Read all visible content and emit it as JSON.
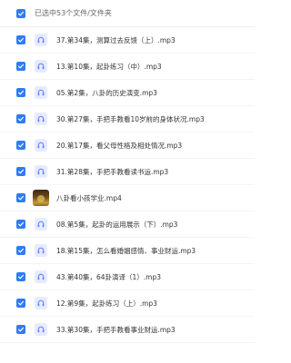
{
  "header": {
    "selected_label": "已选中53个文件/文件夹"
  },
  "files": [
    {
      "name": "37.第34集，测算过去反馈（上）.mp3",
      "kind": "audio"
    },
    {
      "name": "13.第10集，起卦练习（中）.mp3",
      "kind": "audio"
    },
    {
      "name": "05.第2集，八卦的历史演变.mp3",
      "kind": "audio"
    },
    {
      "name": "30.第27集，手把手教看10岁前的身体状况.mp3",
      "kind": "audio"
    },
    {
      "name": "20.第17集，看父母性格及相处情况.mp3",
      "kind": "audio"
    },
    {
      "name": "31.第28集，手把手教看读书运.mp3",
      "kind": "audio"
    },
    {
      "name": "八卦看小孩学业.mp4",
      "kind": "video"
    },
    {
      "name": "08.第5集，起卦的运用展示（下）.mp3",
      "kind": "audio"
    },
    {
      "name": "18.第15集，怎么看婚姻感情、事业财运.mp3",
      "kind": "audio"
    },
    {
      "name": "43.第40集，64卦演译（1）.mp3",
      "kind": "audio"
    },
    {
      "name": "12.第9集，起卦练习（上）.mp3",
      "kind": "audio"
    },
    {
      "name": "33.第30集，手把手教看事业财运.mp3",
      "kind": "audio"
    }
  ],
  "colors": {
    "checkbox": "#2f7cf6",
    "audio_icon_bg": "#e6ebff",
    "audio_icon_fg": "#5b7cf7"
  },
  "icons": {
    "checkbox": "check-icon",
    "audio": "headphones-icon",
    "video": "video-thumbnail"
  }
}
